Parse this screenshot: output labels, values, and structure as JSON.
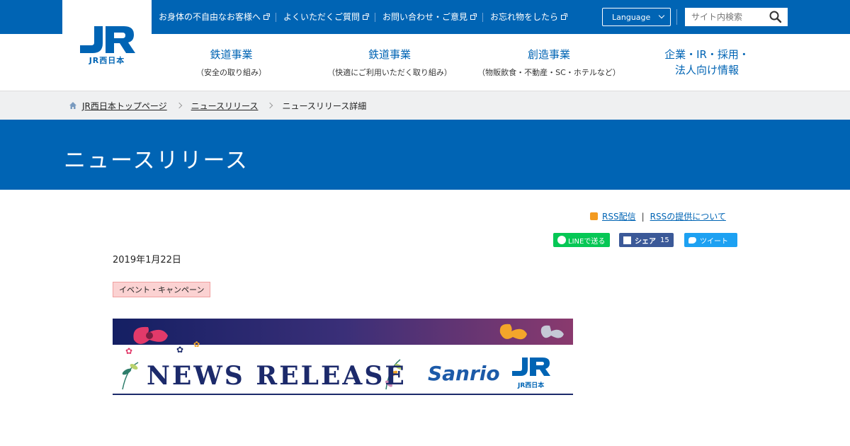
{
  "header": {
    "logo_text": "JR西日本",
    "utility_links": [
      {
        "label": "お身体の不自由なお客様へ"
      },
      {
        "label": "よくいただくご質問"
      },
      {
        "label": "お問い合わせ・ご意見"
      },
      {
        "label": "お忘れ物をしたら"
      }
    ],
    "language_label": "Language",
    "search_placeholder": "サイト内検索"
  },
  "global_nav": [
    {
      "main": "鉄道事業",
      "sub": "（安全の取り組み）"
    },
    {
      "main": "鉄道事業",
      "sub": "（快適にご利用いただく取り組み）"
    },
    {
      "main": "創造事業",
      "sub": "（物販飲食・不動産・SC・ホテルなど）"
    },
    {
      "main": "企業・IR・採用・",
      "main2": "法人向け情報"
    }
  ],
  "breadcrumb": {
    "home": "JR西日本トップページ",
    "level1": "ニュースリリース",
    "current": "ニュースリリース詳細"
  },
  "page_title": "ニュースリリース",
  "rss": {
    "feed": "RSS配信",
    "about": "RSSの提供について"
  },
  "share": {
    "line": "LINEで送る",
    "facebook": "シェア",
    "facebook_count": "15",
    "twitter": "ツイート"
  },
  "article": {
    "date": "2019年1月22日",
    "category": "イベント・キャンペーン",
    "banner_title": "NEWS RELEASE",
    "banner_brand": "Sanrio",
    "banner_logo_sub": "JR西日本"
  },
  "colors": {
    "brand_blue": "#0064b4",
    "banner_navy": "#1c2a6b",
    "banner_purple": "#8a3a6e",
    "tag_pink": "#fbd2d2"
  }
}
